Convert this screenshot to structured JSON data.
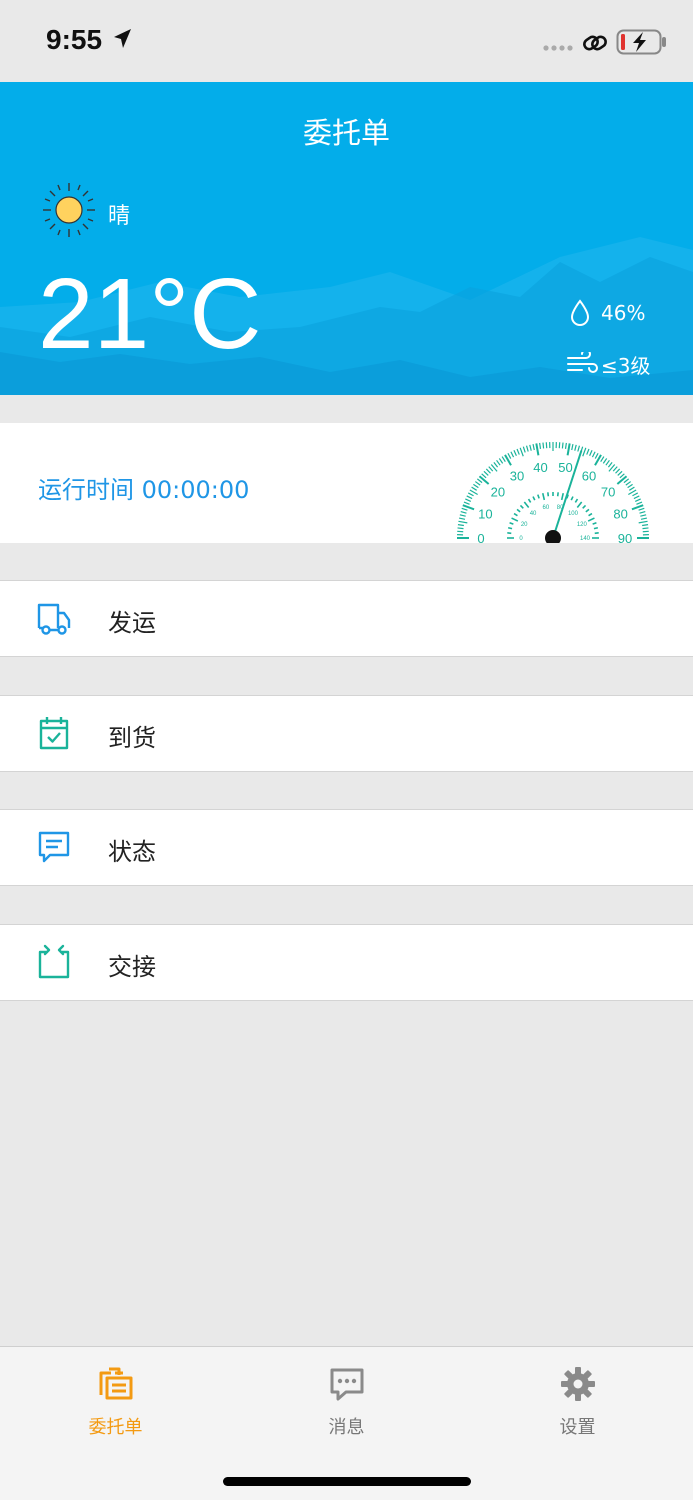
{
  "status_bar": {
    "time": "9:55"
  },
  "header": {
    "title": "委托单"
  },
  "weather": {
    "condition": "晴",
    "temperature": "21°C",
    "humidity": "46%",
    "wind": "≤3级",
    "condition_icon": "sun-icon",
    "humidity_icon": "water-drop-icon",
    "wind_icon": "wind-icon"
  },
  "runtime": {
    "label": "运行时间 00:00:00",
    "gauge_outer_ticks": [
      "0",
      "10",
      "20",
      "30",
      "40",
      "50",
      "60",
      "70",
      "80",
      "90"
    ],
    "gauge_inner_ticks": [
      "0",
      "20",
      "40",
      "60",
      "80",
      "100",
      "120",
      "140"
    ]
  },
  "menu": {
    "items": [
      {
        "label": "发运",
        "icon": "truck-icon"
      },
      {
        "label": "到货",
        "icon": "calendar-check-icon"
      },
      {
        "label": "状态",
        "icon": "message-icon"
      },
      {
        "label": "交接",
        "icon": "handover-icon"
      }
    ]
  },
  "tabs": [
    {
      "label": "委托单",
      "icon": "orders-icon",
      "active": true
    },
    {
      "label": "消息",
      "icon": "chat-icon",
      "active": false
    },
    {
      "label": "设置",
      "icon": "gear-icon",
      "active": false
    }
  ],
  "colors": {
    "header_bg": "#03adea",
    "accent_blue": "#1f96e6",
    "teal": "#1ab39a",
    "tab_active": "#f39a12",
    "tab_inactive": "#8a8a8a"
  }
}
